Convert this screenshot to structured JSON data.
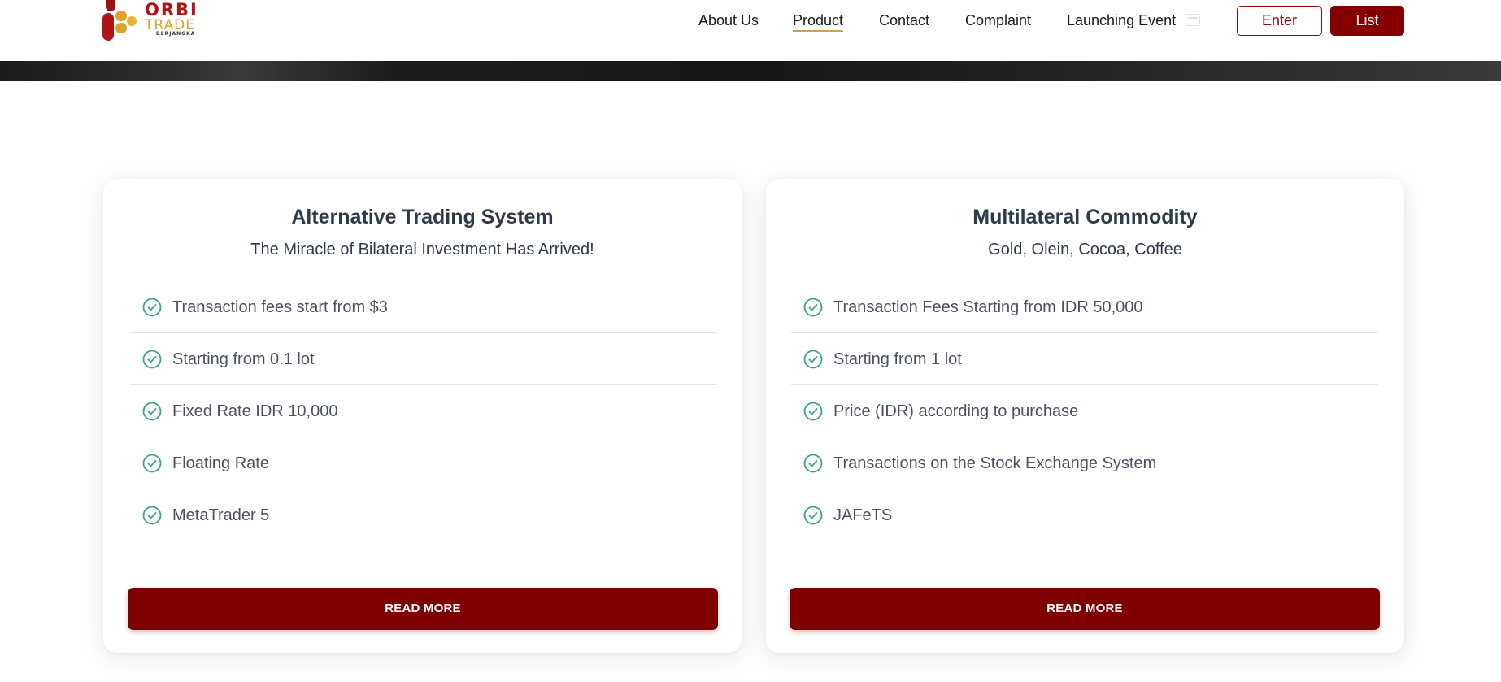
{
  "brand": {
    "line1": "ORBI",
    "line2": "TRADE",
    "line3": "BERJANGKA",
    "colors": {
      "primary": "#850000",
      "gold": "#d9a32c",
      "check": "#3aa57c"
    }
  },
  "nav": {
    "items": [
      {
        "label": "About Us",
        "active": false
      },
      {
        "label": "Product",
        "active": true
      },
      {
        "label": "Contact",
        "active": false
      },
      {
        "label": "Complaint",
        "active": false
      },
      {
        "label": "Launching Event",
        "active": false
      }
    ],
    "event_icon": "calendar-icon",
    "enter_label": "Enter",
    "list_label": "List"
  },
  "cards": [
    {
      "title": "Alternative Trading System",
      "subtitle": "The Miracle of Bilateral Investment Has Arrived!",
      "features": [
        "Transaction fees start from $3",
        "Starting from 0.1 lot",
        "Fixed Rate IDR 10,000",
        "Floating Rate",
        "MetaTrader 5"
      ],
      "button_label": "READ MORE"
    },
    {
      "title": "Multilateral Commodity",
      "subtitle": "Gold, Olein, Cocoa, Coffee",
      "features": [
        "Transaction Fees Starting from IDR 50,000",
        "Starting from 1 lot",
        "Price (IDR) according to purchase",
        "Transactions on the Stock Exchange System",
        "JAFeTS"
      ],
      "button_label": "READ MORE"
    }
  ]
}
